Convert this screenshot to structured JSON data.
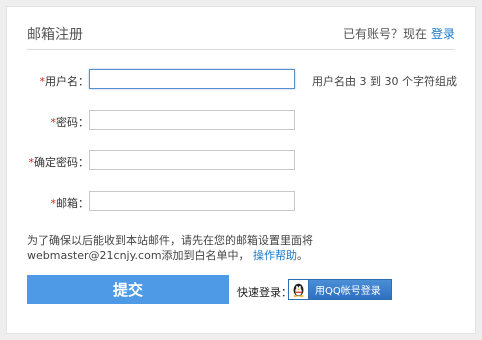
{
  "header": {
    "title": "邮箱注册",
    "login_prompt": "已有账号？现在",
    "login_link": "登录"
  },
  "form": {
    "required_mark": "*",
    "fields": [
      {
        "label": "用户名：",
        "value": "",
        "hint": "用户名由 3 到 30 个字符组成"
      },
      {
        "label": "密码：",
        "value": ""
      },
      {
        "label": "确定密码：",
        "value": ""
      },
      {
        "label": "邮箱：",
        "value": ""
      }
    ]
  },
  "note": {
    "line1": "为了确保以后能收到本站邮件，请先在您的邮箱设置里面将",
    "line2": "webmaster@21cnjy.com添加到白名单中，",
    "help_link": "操作帮助",
    "end": "。"
  },
  "actions": {
    "submit_label": "提交",
    "quick_login_label": "快速登录：",
    "qq_button_label": "用QQ帐号登录"
  },
  "icons": {
    "qq": "qq-penguin-icon"
  },
  "colors": {
    "accent": "#4e9ae6",
    "link": "#1a79c9",
    "required": "#e02020"
  }
}
